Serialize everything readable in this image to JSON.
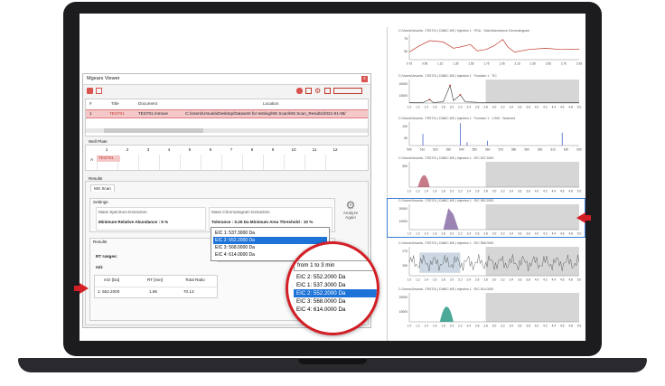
{
  "window": {
    "title": "Mgears Viewer",
    "close_label": "x"
  },
  "toolbar": {
    "icons": [
      "folder-icon",
      "export-icon",
      "database-icon",
      "window-icon",
      "gear-icon",
      "clipboard-icon",
      "table-icon"
    ]
  },
  "doc_table": {
    "headers": [
      "#",
      "Title",
      "Document",
      "Location"
    ],
    "row": {
      "index": "1",
      "title": "TES701",
      "document": "TES701.mmove",
      "location": "C:/Users/Ursuela/Desktop/Datasets for testing/MS Scan/MS Scan_Results/2021-01-08/"
    }
  },
  "well_plate": {
    "label": "Well Plate",
    "columns": [
      "1",
      "2",
      "3",
      "4",
      "5",
      "6",
      "7",
      "8",
      "9",
      "10",
      "11",
      "12"
    ],
    "row_label": "A",
    "selected_cell": "TES701"
  },
  "results": {
    "label": "Results",
    "tab": "MS Scan",
    "settings_label": "Settings",
    "spectrum_title": "Mass Spectrum Extraction",
    "spectrum_value": "Minimum Relative Abundance : 5 %",
    "chrom_title": "Mass Chromatogram Extraction",
    "chrom_value": "Tolerance : 0.25 Da   Minimum Area Threshold : 10 %",
    "analyze_label_1": "Analyze",
    "analyze_label_2": "Again",
    "inner_label": "Results",
    "rt_label": "RT ranges:",
    "mz_label": "m/z",
    "table_headers": [
      "m/z [Da]",
      "RT [min]",
      "Total Ratio"
    ],
    "table_row": [
      "1: 552.2000",
      "1.96",
      "70.13"
    ],
    "rt_selected": "from 1 to 3 min",
    "dropdown_items": [
      "EIC 1: 537.3000 Da",
      "EIC 2: 552.2000 Da",
      "EIC 3: 568.0000 Da",
      "EIC 4: 614.0000 Da"
    ],
    "dropdown_selected_index": 1
  },
  "magnifier": {
    "select_value": "from 1 to 3 min",
    "items": [
      "EIC 2: 552.2000 Da",
      "EIC 1: 537.3000 Da",
      "EIC 2: 552.2000 Da",
      "EIC 3: 568.0000 Da",
      "EIC 4: 614.0000 Da"
    ],
    "selected_index": 2
  },
  "charts": [
    {
      "title": "C:/Users/Ursuela...TES701 | DAB/C.MS | Injection 1 · PDA - Total Absorbance Chromatogram",
      "ticks": [
        "0.75",
        "0.95",
        "1.15",
        "1.35",
        "1.55",
        "1.75",
        "1.95",
        "2.15",
        "2.35",
        "2.55",
        "2.75",
        "2.95"
      ],
      "y_ticks": [
        "75",
        "50"
      ]
    },
    {
      "title": "C:/Users/Ursuela...TES701 | DAB/C.MS | Injection 1 · Function 1 · TIC",
      "ticks": [
        "1.0",
        "1.2",
        "1.4",
        "1.6",
        "1.8",
        "2.0",
        "2.2",
        "2.4",
        "2.6",
        "2.8",
        "3.0",
        "3.2",
        "3.4",
        "3.6",
        "3.8",
        "4.0",
        "4.2",
        "4.4",
        "4.6",
        "4.8",
        "5.0"
      ],
      "y_ticks": [
        "20000",
        "10000"
      ]
    },
    {
      "title": "C:/Users/Ursuela...TES701 | DAB/C.MS | Injection 1 · Function 1 · 1.963 · Scanned",
      "ticks": [
        "500",
        "510",
        "520",
        "530",
        "540",
        "550",
        "560",
        "570",
        "580",
        "590",
        "600",
        "610",
        "620",
        "630"
      ],
      "y_ticks": [
        "100",
        "50"
      ]
    },
    {
      "title": "C:/Users/Ursuela...TES701 | DAB/C.MS | Injection 1 · EIC 537.3000",
      "ticks": [
        "1.0",
        "1.2",
        "1.4",
        "1.6",
        "1.8",
        "2.0",
        "2.2",
        "2.4",
        "2.6",
        "2.8",
        "3.0",
        "3.2",
        "3.4",
        "3.6",
        "3.8",
        "4.0",
        "4.2",
        "4.4",
        "4.6",
        "4.8",
        "5.0"
      ],
      "y_ticks": [
        "500"
      ]
    },
    {
      "title": "C:/Users/Ursuela...TES701 | DAB/C.MS | Injection 1 · EIC 552.2000",
      "ticks": [
        "1.0",
        "1.2",
        "1.4",
        "1.6",
        "1.8",
        "2.0",
        "2.2",
        "2.4",
        "2.6",
        "2.8",
        "3.0",
        "3.2",
        "3.4",
        "3.6",
        "3.8",
        "4.0",
        "4.2",
        "4.4",
        "4.6",
        "4.8",
        "5.0"
      ],
      "y_ticks": [
        "20000",
        "10000"
      ]
    },
    {
      "title": "C:/Users/Ursuela...TES701 | DAB/C.MS | Injection 1 · EIC 568.0000",
      "ticks": [
        "1.0",
        "1.2",
        "1.4",
        "1.6",
        "1.8",
        "2.0",
        "2.2",
        "2.4",
        "2.6",
        "2.8",
        "3.0",
        "3.2",
        "3.4",
        "3.6",
        "3.8",
        "4.0",
        "4.2",
        "4.4",
        "4.6",
        "4.8",
        "5.0"
      ],
      "y_ticks": [
        "270",
        "250"
      ]
    },
    {
      "title": "C:/Users/Ursuela...TES701 | DAB/C.MS | Injection 1 · EIC 614.0000",
      "ticks": [
        "1.0",
        "1.2",
        "1.4",
        "1.6",
        "1.8",
        "2.0",
        "2.2",
        "2.4",
        "2.6",
        "2.8",
        "3.0",
        "3.2",
        "3.4",
        "3.6",
        "3.8",
        "4.0",
        "4.2",
        "4.4",
        "4.6",
        "4.8",
        "5.0"
      ],
      "y_ticks": [
        "20000",
        "10000"
      ]
    }
  ],
  "colors": {
    "accent": "#d31f26",
    "selection": "#1e73d8",
    "trace_red": "#c0392b",
    "peak_red": "#b75a6a",
    "peak_purple": "#8a6fa6",
    "peak_teal": "#2c9a86",
    "noise_blue": "#2f5f8a"
  }
}
